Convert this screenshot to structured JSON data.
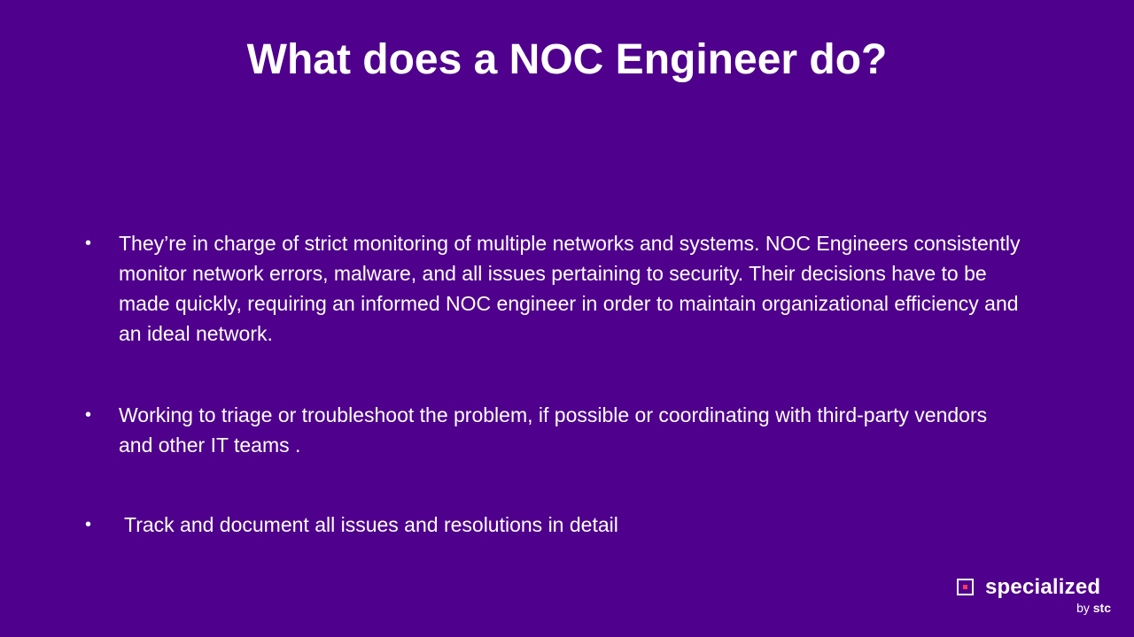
{
  "slide": {
    "title": "What does a NOC Engineer do?",
    "bullets": [
      "They’re in charge of strict monitoring of multiple networks and systems. NOC Engineers consistently monitor network errors, malware, and all issues pertaining to security. Their decisions have to be made quickly, requiring an informed NOC engineer in order to maintain organizational efficiency and an ideal network.",
      "Working to triage or troubleshoot the problem, if possible or coordinating with third-party vendors and other IT teams .",
      "Track and document all issues and resolutions in detail"
    ]
  },
  "logo": {
    "wordmark": "specialized",
    "by": "by",
    "brand": "stc",
    "mark_icon": "square-logo-icon",
    "accent_color": "#ff375e"
  },
  "colors": {
    "background": "#4f008c",
    "text": "#ffffff"
  }
}
